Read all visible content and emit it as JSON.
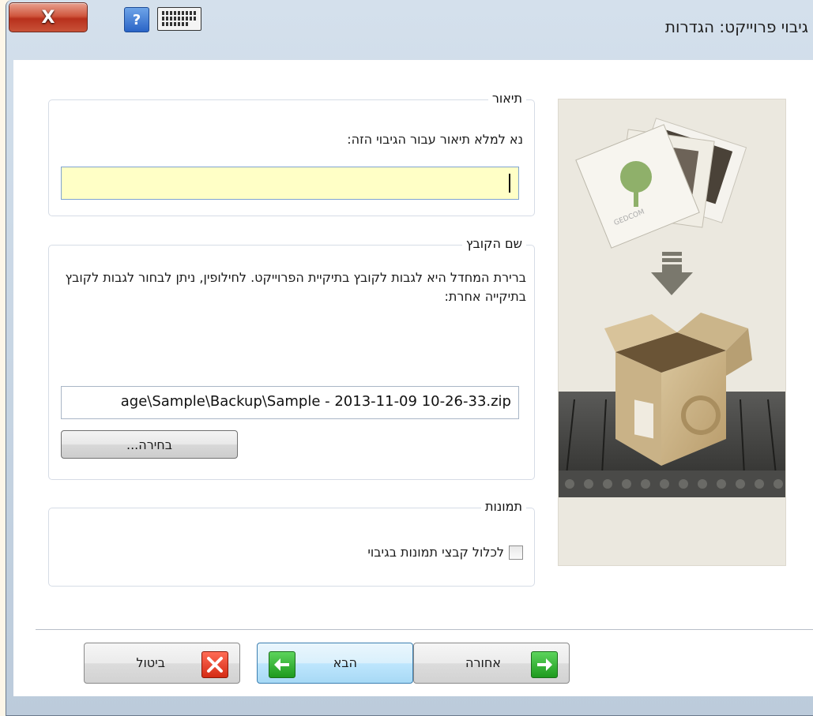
{
  "window": {
    "title": "גיבוי פרוייקט: הגדרות",
    "close_label": "X",
    "help_label": "?"
  },
  "description_group": {
    "title": "תיאור",
    "prompt": "נא למלא תיאור עבור הגיבוי הזה:",
    "value": ""
  },
  "filename_group": {
    "title": "שם הקובץ",
    "explanation": "ברירת המחדל היא לגבות לקובץ בתיקיית הפרוייקט. לחילופין, ניתן לבחור לגבות לקובץ בתיקייה אחרת:",
    "path": "age\\Sample\\Backup\\Sample - 2013-11-09 10-26-33.zip",
    "browse_label": "בחירה..."
  },
  "photos_group": {
    "title": "תמונות",
    "checkbox_label": "לכלול קבצי תמונות בגיבוי",
    "checked": false
  },
  "illustration": {
    "card_text": "GEDCOM"
  },
  "buttons": {
    "back_label": "אחורה",
    "next_label": "הבא",
    "cancel_label": "ביטול"
  },
  "colors": {
    "input_highlight": "#ffffc6",
    "accent": "#3c7fb1",
    "green_icon": "#1e9a1e",
    "red_icon": "#d42b14"
  }
}
